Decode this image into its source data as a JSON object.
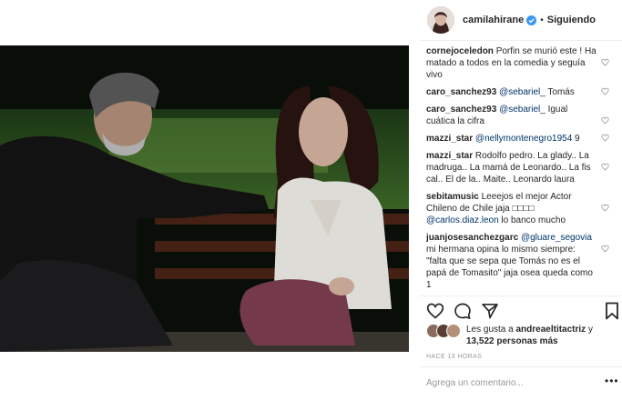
{
  "post": {
    "username": "camilahirane",
    "separator": "•",
    "follow_label": "Siguiendo"
  },
  "comments": [
    {
      "user": "cornejoceledon",
      "parts": [
        {
          "t": "Porfin se murió este ! Ha matado a todos en la comedia y seguía vivo"
        }
      ]
    },
    {
      "user": "caro_sanchez93",
      "parts": [
        {
          "m": "@sebariel_"
        },
        {
          "t": " Tomás"
        }
      ]
    },
    {
      "user": "caro_sanchez93",
      "parts": [
        {
          "m": "@sebariel_"
        },
        {
          "t": " Igual cuática la cifra"
        }
      ]
    },
    {
      "user": "mazzi_star",
      "parts": [
        {
          "m": "@nellymontenegro1954"
        },
        {
          "t": " 9"
        }
      ]
    },
    {
      "user": "mazzi_star",
      "parts": [
        {
          "t": "Rodolfo pedro. La glady.. La madruga.. La mamá de Leonardo.. La fis cal.. El de la.. Maite.. Leonardo laura"
        }
      ]
    },
    {
      "user": "sebitamusic",
      "parts": [
        {
          "t": "Leeejos el mejor Actor Chileno de Chile jaja □□□□ "
        },
        {
          "m": "@carlos.diaz.leon"
        },
        {
          "t": " lo banco mucho"
        }
      ]
    },
    {
      "user": "juanjosesanchezgarc",
      "parts": [
        {
          "m": "@gluare_segovia"
        },
        {
          "t": " mi hermana opina lo mismo siempre: \"falta que se sepa que Tomás no es el papá de Tomasito\" jaja osea queda como 1"
        }
      ]
    }
  ],
  "likes": {
    "text_prefix": "Les gusta a ",
    "liker": "andreaeltitactriz",
    "text_mid": " y",
    "count": "13,522 personas más"
  },
  "time_ago": "HACE 13 HORAS",
  "add_comment_placeholder": "Agrega un comentario...",
  "more_label": "•••",
  "icons": [
    "verified-icon",
    "heart-icon",
    "comment-icon",
    "share-icon",
    "bookmark-icon"
  ]
}
